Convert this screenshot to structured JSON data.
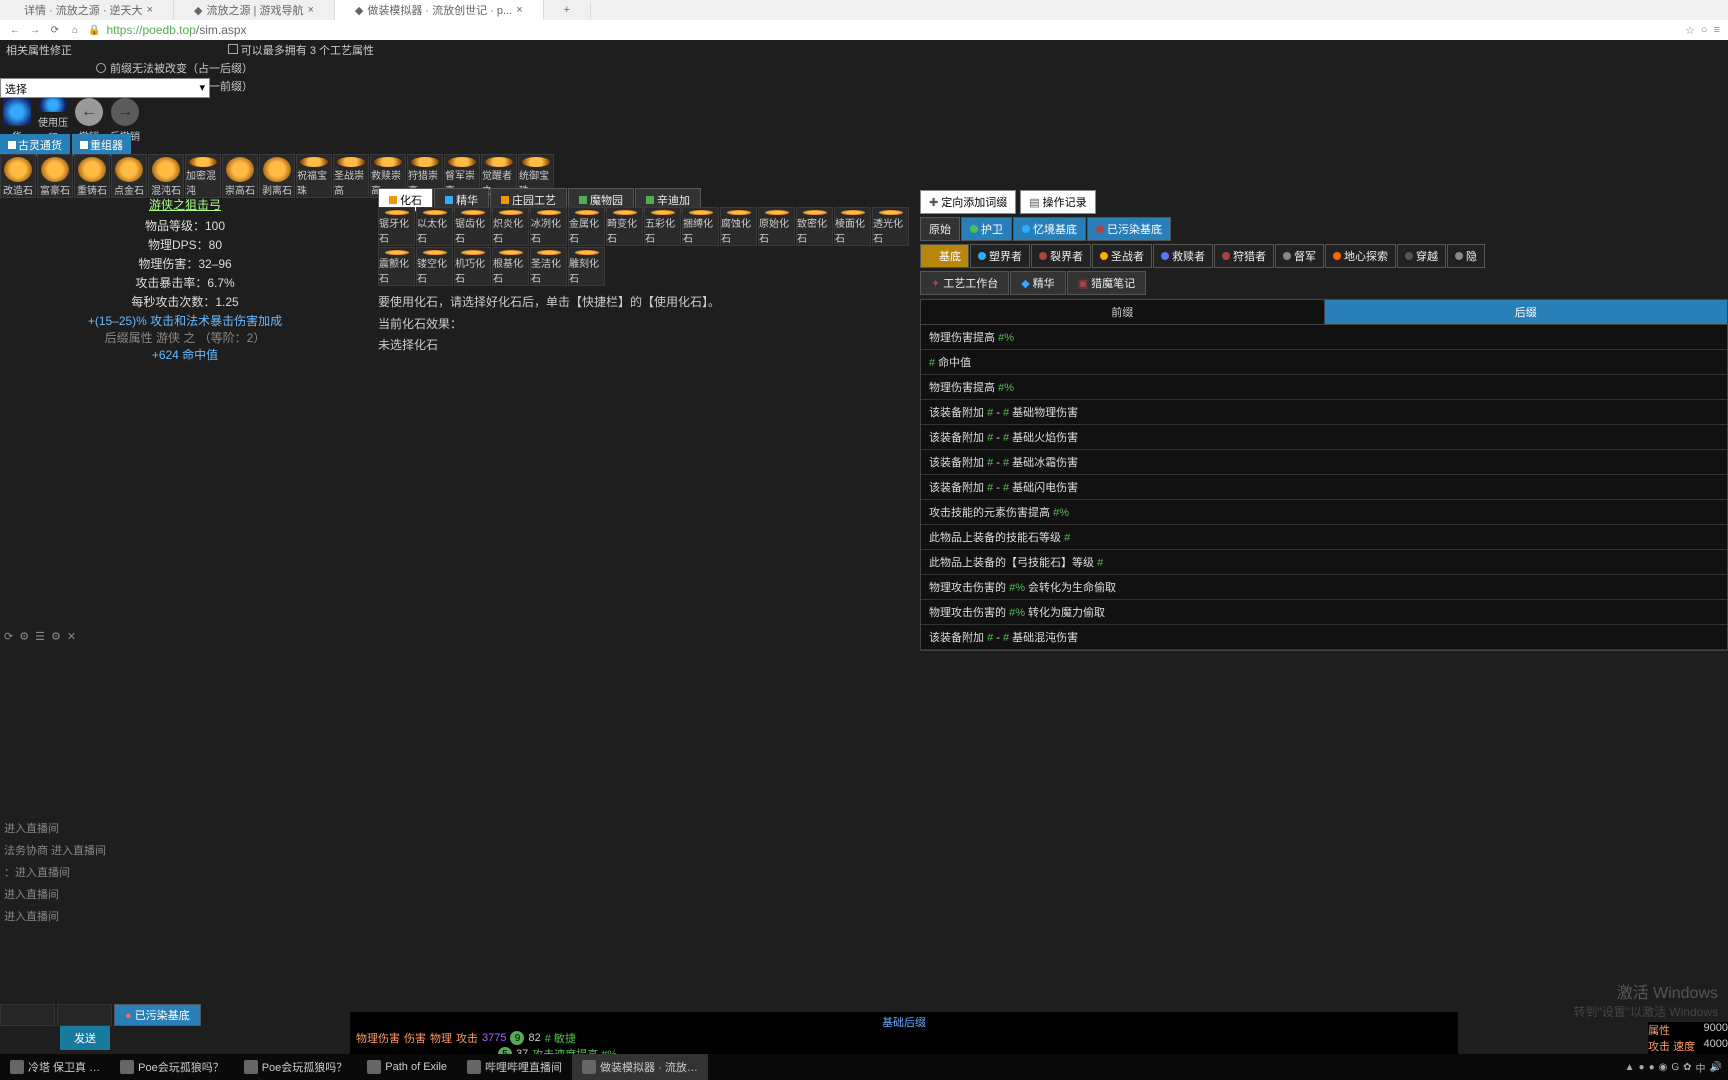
{
  "browser": {
    "tabs": [
      "详情 · 流放之源 · 逆天大",
      "流放之源 | 游戏导航",
      "做装模拟器 · 流放创世记 · p..."
    ],
    "url_domain": "https://poedb.top",
    "url_path": "/sim.aspx"
  },
  "options": {
    "line0": "可以最多拥有 3 个工艺属性",
    "line1": "相关属性修正",
    "radio1": "前缀无法被改变（占一后缀）",
    "radio2": "后缀无法被改变（占一前缀）"
  },
  "select_placeholder": "选择",
  "actions": [
    "华",
    "使用压印",
    "撤销",
    "反撤销"
  ],
  "toptabs": [
    "古灵通货",
    "重组器"
  ],
  "currency": [
    "改造石",
    "富豪石",
    "重铸石",
    "点金石",
    "混沌石",
    "加密混沌",
    "崇高石",
    "剥离石",
    "祝福宝珠",
    "圣战崇高",
    "救赎崇高",
    "狩猎崇高",
    "督军崇高",
    "觉醒者之",
    "统御宝珠"
  ],
  "item": {
    "name": "游侠之狙击弓",
    "lvl": "物品等级：100",
    "dps": "物理DPS：80",
    "phys": "物理伤害：32–96",
    "crit": "攻击暴击率：6.7%",
    "aps": "每秒攻击次数：1.25",
    "imp1": "+(15–25)% 攻击和法术暴击伤害加成",
    "suf": "后缀属性 游侠 之 （等阶：2）",
    "suf1": "+624 命中值"
  },
  "fossil_tabs": [
    "化石",
    "精华",
    "庄园工艺",
    "魔物园",
    "辛迪加"
  ],
  "fossils_r1": [
    "锯牙化石",
    "以太化石",
    "锯齿化石",
    "炽炎化石",
    "冰冽化石",
    "金属化石",
    "畸变化石",
    "五彩化石",
    "捆缚化石",
    "腐蚀化石",
    "原始化石",
    "致密化石",
    "棱面化石",
    "透光化石"
  ],
  "fossils_r2": [
    "震颤化石",
    "镂空化石",
    "机巧化石",
    "根基化石",
    "圣洁化石",
    "雕刻化石"
  ],
  "fossil_help1": "要使用化石，请选择好化石后，单击【快捷栏】的【使用化石】。",
  "fossil_help2": "当前化石效果：",
  "fossil_help3": "未选择化石",
  "rp": {
    "top": [
      "定向添加词缀",
      "操作记录"
    ],
    "t2": [
      "原始",
      "护卫",
      "忆境基底",
      "已污染基底"
    ],
    "fac": [
      "基底",
      "塑界者",
      "裂界者",
      "圣战者",
      "救赎者",
      "狩猎者",
      "督军",
      "地心探索",
      "穿越",
      "隐"
    ],
    "sub": [
      "工艺工作台",
      "精华",
      "猎魔笔记"
    ],
    "hdr": [
      "前缀",
      "后缀"
    ]
  },
  "mods": [
    {
      "t": "物理伤害提高 #%",
      "x": ""
    },
    {
      "t": "# 命中值",
      "x": ""
    },
    {
      "t": "物理伤害提高 #%",
      "x": ""
    },
    {
      "t": "该装备附加 # - # 基础物理伤害",
      "x": ""
    },
    {
      "t": "该装备附加 # - # 基础火焰伤害",
      "x": ""
    },
    {
      "t": "该装备附加 # - # 基础冰霜伤害",
      "x": ""
    },
    {
      "t": "该装备附加 # - # 基础闪电伤害",
      "x": ""
    },
    {
      "t": "攻击技能的元素伤害提高 #%",
      "x": ""
    },
    {
      "t": "此物品上装备的技能石等级 #",
      "x": ""
    },
    {
      "t": "此物品上装备的【弓技能石】等级 #",
      "x": ""
    },
    {
      "t": "物理攻击伤害的 #% 会转化为生命偷取",
      "x": ""
    },
    {
      "t": "物理攻击伤害的 #% 转化为魔力偷取",
      "x": ""
    },
    {
      "t": "该装备附加 # - # 基础混沌伤害",
      "x": ""
    }
  ],
  "chat": {
    "l1": "进入直播间",
    "l2": "法务协商 进入直播间",
    "l3": "：进入直播间",
    "l4": "进入直播间",
    "l5": "进入直播间",
    "tabs": [
      "已污染基底"
    ],
    "send": "发送"
  },
  "bottom": {
    "title": "基础后缀",
    "r1": {
      "a": "物理伤害",
      "b": "伤害",
      "c": "物理",
      "d": "攻击",
      "v1": "3775",
      "badge1": "9",
      "v2": "82",
      "e": "# 敏捷"
    },
    "r2": {
      "badge": "5",
      "v": "37",
      "t": "攻击速度提高 #%"
    },
    "right": [
      {
        "k": "属性",
        "v": "9000"
      },
      {
        "k": "攻击",
        "k2": "速度",
        "v": "4000"
      }
    ]
  },
  "watermark": {
    "h": "激活 Windows",
    "s": "转到\"设置\"以激活 Windows"
  },
  "taskbar": [
    "冷塔 保卫真 …",
    "Poe会玩孤狼吗？",
    "Poe会玩孤狼吗？",
    "Path of Exile",
    "哔哩哔哩直播间",
    "做装模拟器 · 流放…"
  ],
  "tray_time": ""
}
